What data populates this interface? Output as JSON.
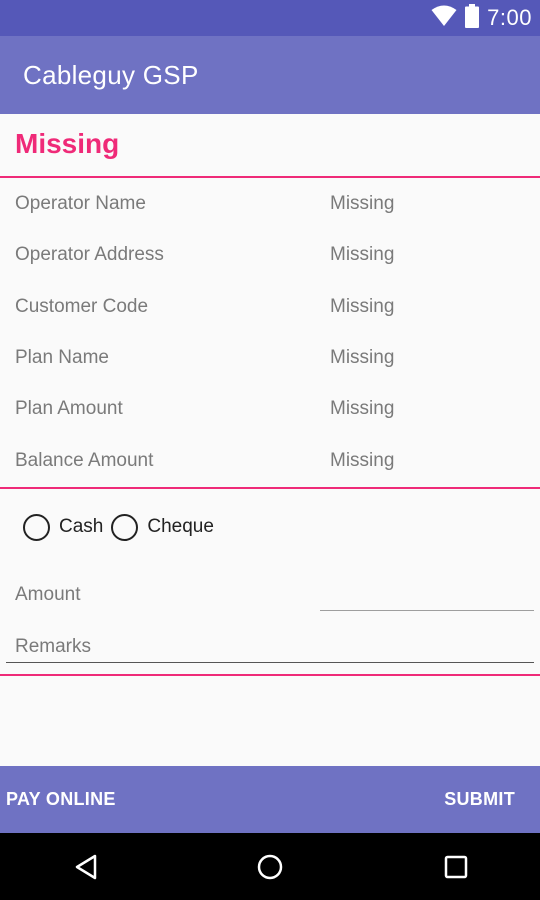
{
  "status_bar": {
    "time": "7:00",
    "icons": [
      "wifi-icon",
      "battery-icon"
    ]
  },
  "app_bar": {
    "title": "Cableguy GSP"
  },
  "section": {
    "title": "Missing"
  },
  "details": [
    {
      "label": "Operator Name",
      "value": "Missing"
    },
    {
      "label": "Operator Address",
      "value": "Missing"
    },
    {
      "label": "Customer Code",
      "value": "Missing"
    },
    {
      "label": "Plan Name",
      "value": "Missing"
    },
    {
      "label": "Plan Amount",
      "value": "Missing"
    },
    {
      "label": "Balance Amount",
      "value": "Missing"
    }
  ],
  "payment_mode": {
    "options": [
      "Cash",
      "Cheque"
    ]
  },
  "form": {
    "amount_label": "Amount",
    "amount_value": "",
    "remarks_placeholder": "Remarks"
  },
  "actions": {
    "pay_online": "PAY ONLINE",
    "submit": "SUBMIT"
  },
  "nav": {
    "icons": [
      "back-icon",
      "home-icon",
      "recents-icon"
    ]
  },
  "colors": {
    "status_bar": "#5558b8",
    "primary": "#6f72c3",
    "accent": "#ef2a78"
  }
}
